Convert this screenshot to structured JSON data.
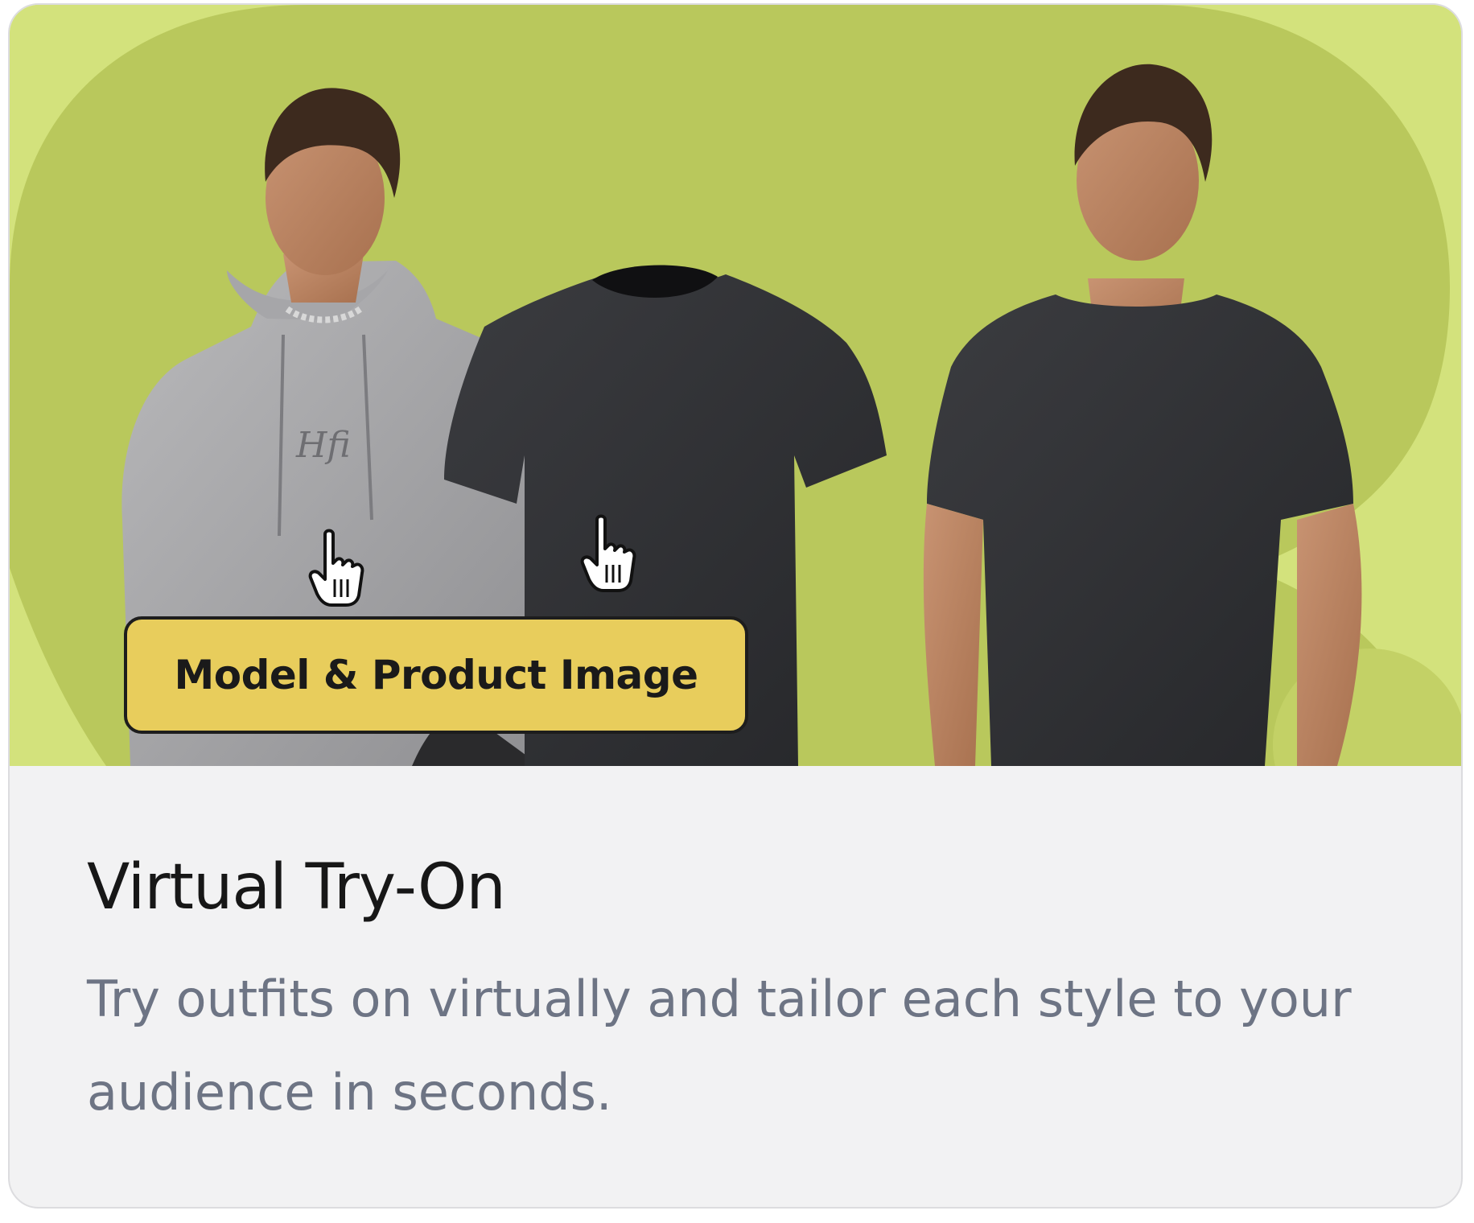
{
  "card": {
    "badge_label": "Model & Product Image",
    "title": "Virtual Try-On",
    "description": "Try outfits on virtually and tailor each style to your audience in seconds."
  },
  "hero": {
    "hoodie_logo": "Hfi"
  },
  "colors": {
    "hero_background_light": "#d3e27c",
    "hero_background_dark": "#b9c85c",
    "badge_fill": "#e8cd5c",
    "card_background": "#f2f2f3",
    "title_color": "#171717",
    "description_color": "#6d7484"
  },
  "icons": {
    "cursor": "hand-pointer-icon"
  }
}
